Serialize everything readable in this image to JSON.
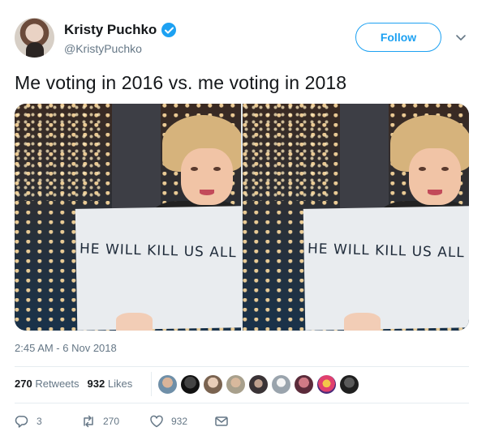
{
  "author": {
    "display_name": "Kristy Puchko",
    "handle": "@KristyPuchko"
  },
  "follow_label": "Follow",
  "tweet_text": "Me voting in 2016 vs. me voting in 2018",
  "media": {
    "sign_text_left": "HE WILL KILL US ALL",
    "sign_text_right": "HE WILL KILL US ALL"
  },
  "timestamp": "2:45 AM - 6 Nov 2018",
  "stats": {
    "retweets_count": "270",
    "retweets_label": "Retweets",
    "likes_count": "932",
    "likes_label": "Likes"
  },
  "actions": {
    "replies": "3",
    "retweets": "270",
    "likes": "932"
  },
  "icons": {
    "verified": "verified-badge-icon",
    "caret": "chevron-down-icon",
    "reply": "reply-icon",
    "retweet": "retweet-icon",
    "like": "heart-icon",
    "dm": "envelope-icon"
  },
  "colors": {
    "accent": "#1da1f2",
    "muted": "#657786",
    "text": "#14171a"
  }
}
